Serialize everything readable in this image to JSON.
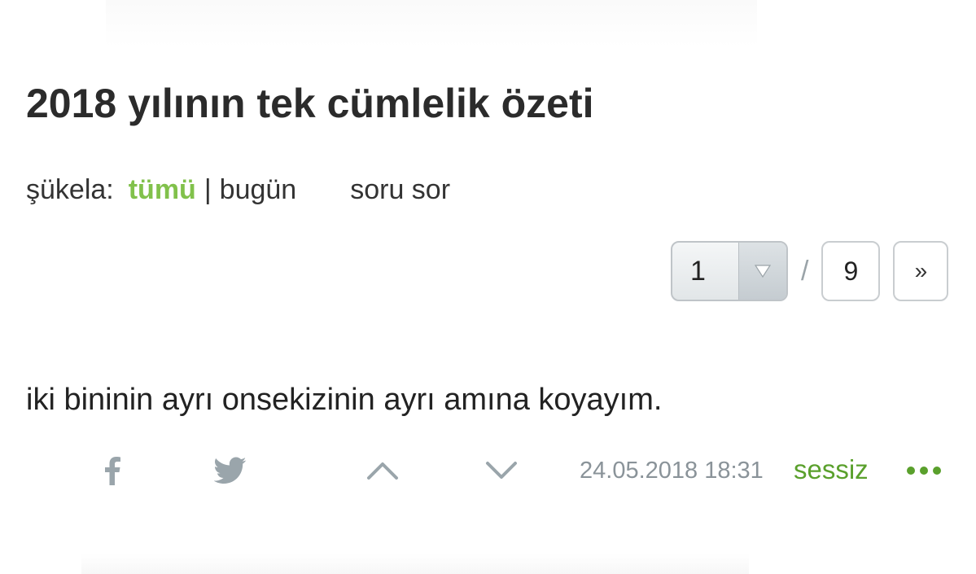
{
  "topic": {
    "title": "2018 yılının tek cümlelik özeti"
  },
  "filters": {
    "label": "şükela:",
    "active": "tümü",
    "separator": "|",
    "today": "bugün",
    "ask": "soru sor"
  },
  "pager": {
    "current_page": "1",
    "separator": "/",
    "total_pages": "9",
    "next_label": "»"
  },
  "entry": {
    "text": "iki bininin ayrı onsekizinin ayrı amına koyayım.",
    "date": "24.05.2018 18:31",
    "author": "sessiz"
  },
  "icons": {
    "share_facebook": "facebook-icon",
    "share_twitter": "twitter-icon",
    "upvote": "chevron-up-icon",
    "downvote": "chevron-down-icon",
    "more": "more-dots-icon"
  },
  "colors": {
    "accent_green": "#81c14b",
    "author_green": "#5aa02c",
    "icon_gray": "#9aa5ab",
    "date_gray": "#8a9399"
  }
}
